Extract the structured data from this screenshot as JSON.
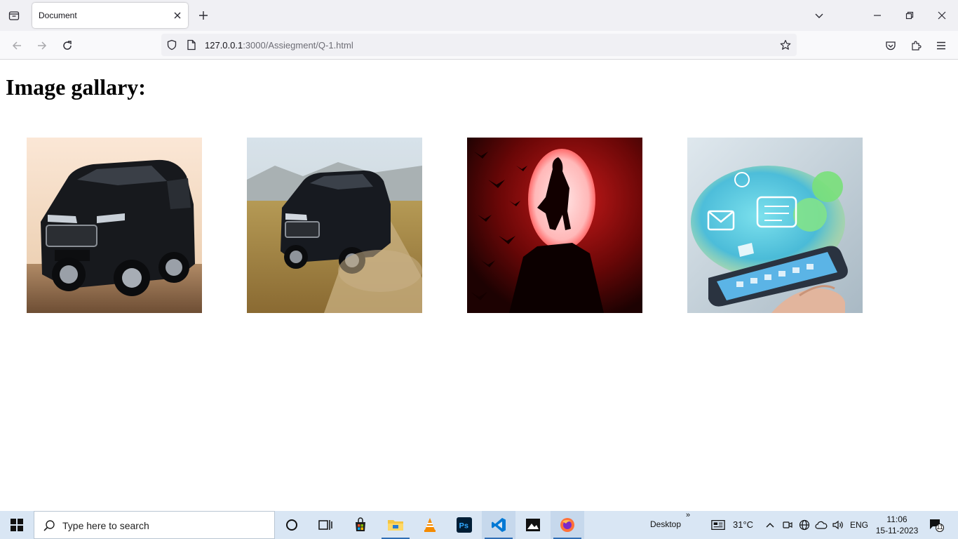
{
  "browser": {
    "tab": {
      "title": "Document"
    },
    "url": {
      "host": "127.0.0.1",
      "rest": ":3000/Assiegment/Q-1.html"
    }
  },
  "page": {
    "heading": "Image gallary:",
    "images": [
      {
        "subject": "Toyota Fortuner SUV (front three-quarter view)"
      },
      {
        "subject": "Toyota Fortuner SUV driving on dirt road"
      },
      {
        "subject": "Silhouette in front of red moon"
      },
      {
        "subject": "Hand holding smartphone with social media icons"
      }
    ]
  },
  "taskbar": {
    "search_placeholder": "Type here to search",
    "desktop_label": "Desktop",
    "weather": "31°C",
    "language": "ENG",
    "time": "11:06",
    "date": "15-11-2023",
    "notification_count": "11"
  }
}
